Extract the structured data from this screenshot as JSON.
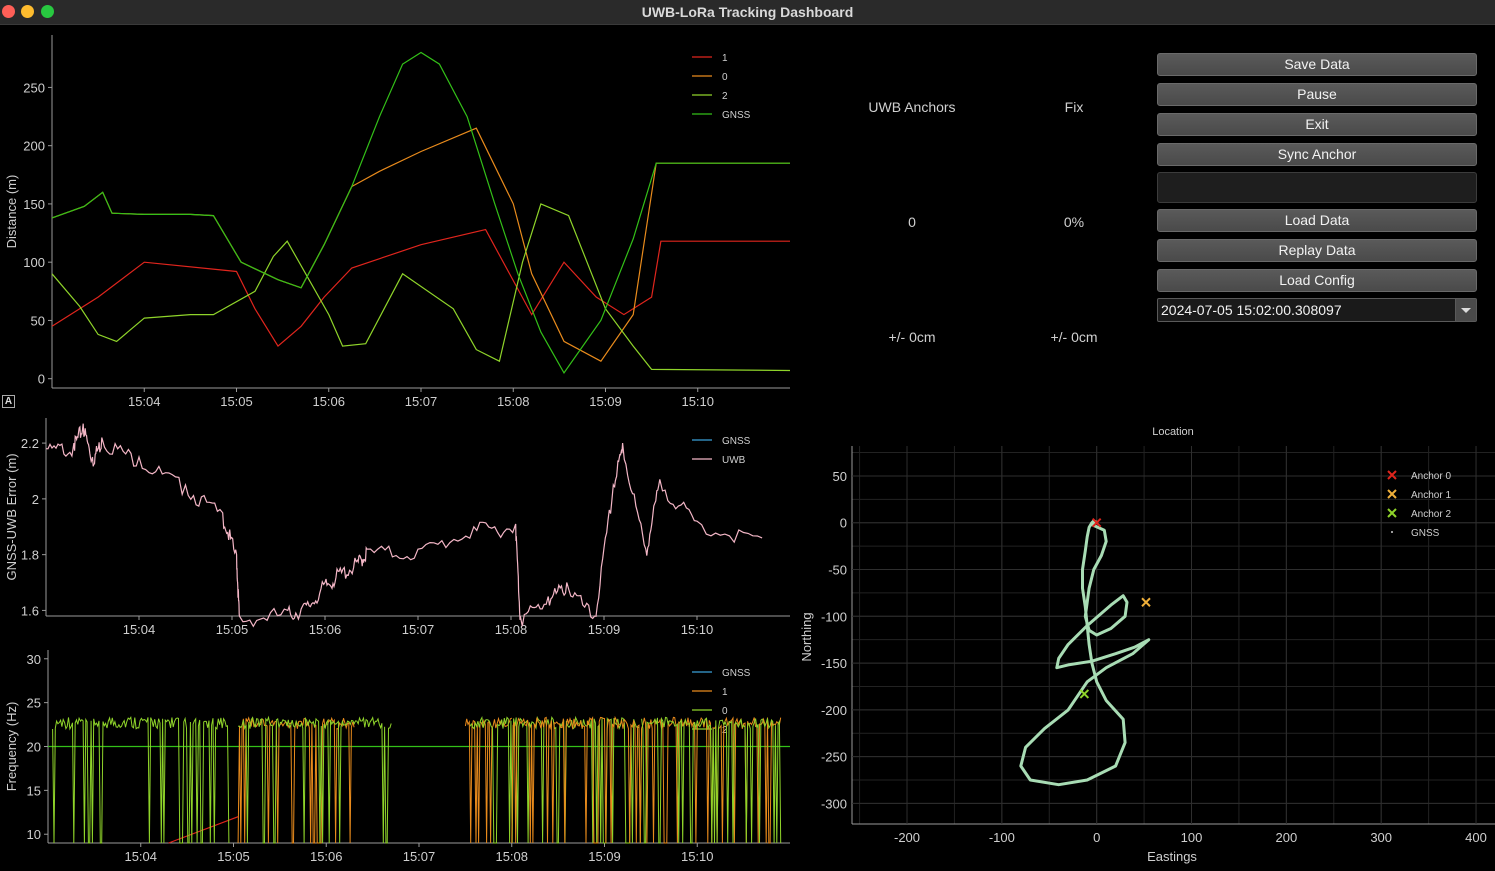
{
  "window": {
    "title": "UWB-LoRa Tracking Dashboard"
  },
  "status": {
    "anchors_header": "UWB Anchors",
    "fix_header": "Fix",
    "anchors_value": "0",
    "fix_value": "0%",
    "anchors_precision": "+/- 0cm",
    "fix_precision": "+/- 0cm"
  },
  "controls": {
    "save": "Save Data",
    "pause": "Pause",
    "exit": "Exit",
    "sync": "Sync Anchor",
    "load": "Load Data",
    "replay": "Replay Data",
    "load_config": "Load Config",
    "timestamp": "2024-07-05 15:02:00.308097",
    "autorange_label": "A"
  },
  "colors": {
    "series1": "#e0251d",
    "series0": "#e98b1c",
    "series2": "#8fd42a",
    "gnss": "#33c018",
    "uwb": "#f3b6c6",
    "gnss_err": "#3aa0d8",
    "track": "#a8dcb4"
  },
  "chart_data": [
    {
      "type": "line",
      "ylabel": "Distance (m)",
      "yticks": [
        0,
        50,
        100,
        150,
        200,
        250
      ],
      "ylim": [
        -8,
        295
      ],
      "xticks": [
        "15:04",
        "15:05",
        "15:06",
        "15:07",
        "15:08",
        "15:09",
        "15:10"
      ],
      "xlim_minutes": [
        3.0,
        11.0
      ],
      "legend": [
        "1",
        "0",
        "2",
        "GNSS"
      ],
      "series": [
        {
          "name": "1",
          "x": [
            3.0,
            3.5,
            4.0,
            5.0,
            5.2,
            5.45,
            5.7,
            5.95,
            6.25,
            7.0,
            7.7,
            8.2,
            8.55,
            8.9,
            9.2,
            9.5,
            9.6,
            11.0
          ],
          "y": [
            45,
            70,
            100,
            92,
            60,
            28,
            45,
            70,
            95,
            115,
            128,
            55,
            100,
            70,
            55,
            70,
            118,
            118
          ]
        },
        {
          "name": "0",
          "x": [
            3.0,
            3.35,
            3.55,
            3.65,
            4.0,
            4.5,
            4.75,
            5.05,
            5.45,
            5.7,
            5.95,
            6.25,
            6.55,
            7.0,
            7.6,
            8.0,
            8.2,
            8.55,
            8.95,
            9.3,
            9.55,
            11.0
          ],
          "y": [
            138,
            148,
            160,
            142,
            141,
            141,
            140,
            100,
            85,
            78,
            115,
            165,
            178,
            195,
            215,
            150,
            90,
            32,
            15,
            55,
            185,
            185
          ]
        },
        {
          "name": "2",
          "x": [
            3.0,
            3.3,
            3.5,
            3.7,
            4.0,
            4.5,
            4.75,
            5.2,
            5.4,
            5.55,
            5.75,
            6.0,
            6.15,
            6.4,
            6.8,
            7.35,
            7.6,
            7.85,
            8.1,
            8.3,
            8.6,
            9.0,
            9.3,
            9.5,
            11.0
          ],
          "y": [
            90,
            62,
            38,
            32,
            52,
            55,
            55,
            75,
            105,
            118,
            90,
            55,
            28,
            30,
            90,
            60,
            25,
            15,
            100,
            150,
            140,
            60,
            28,
            8,
            7
          ]
        },
        {
          "name": "GNSS",
          "x": [
            3.0,
            3.35,
            3.55,
            3.65,
            4.0,
            4.5,
            4.75,
            5.05,
            5.45,
            5.7,
            5.95,
            6.25,
            6.55,
            6.8,
            7.0,
            7.2,
            7.5,
            7.8,
            8.05,
            8.3,
            8.55,
            8.95,
            9.3,
            9.55,
            11.0
          ],
          "y": [
            138,
            148,
            160,
            142,
            141,
            141,
            140,
            100,
            85,
            78,
            115,
            165,
            225,
            270,
            280,
            270,
            225,
            150,
            90,
            40,
            5,
            50,
            120,
            185,
            185
          ]
        }
      ]
    },
    {
      "type": "line",
      "ylabel": "GNSS-UWB Error (m)",
      "yticks": [
        1.6,
        1.8,
        2.0,
        2.2
      ],
      "ylim": [
        1.58,
        2.29
      ],
      "xticks": [
        "15:04",
        "15:05",
        "15:06",
        "15:07",
        "15:08",
        "15:09",
        "15:10"
      ],
      "xlim_minutes": [
        3.0,
        11.0
      ],
      "legend": [
        "GNSS",
        "UWB"
      ],
      "series": [
        {
          "name": "UWB",
          "x": [
            3.0,
            3.3,
            3.4,
            3.5,
            3.6,
            4.0,
            4.5,
            4.9,
            5.05,
            5.08,
            5.6,
            5.8,
            6.0,
            6.15,
            6.35,
            6.45,
            7.0,
            7.6,
            8.05,
            8.1,
            8.4,
            8.6,
            8.9,
            9.1,
            9.2,
            9.45,
            9.6,
            10.0,
            10.7
          ],
          "y": [
            2.18,
            2.2,
            2.27,
            2.15,
            2.22,
            2.15,
            2.05,
            1.95,
            1.8,
            1.58,
            1.6,
            1.62,
            1.7,
            1.74,
            1.78,
            1.82,
            1.82,
            1.9,
            1.91,
            1.58,
            1.65,
            1.7,
            1.58,
            2.05,
            2.2,
            1.82,
            2.07,
            1.92,
            1.86
          ]
        }
      ]
    },
    {
      "type": "line",
      "ylabel": "Frequency (Hz)",
      "yticks": [
        10,
        15,
        20,
        25,
        30
      ],
      "ylim": [
        9,
        31
      ],
      "xticks": [
        "15:04",
        "15:05",
        "15:06",
        "15:07",
        "15:08",
        "15:09",
        "15:10"
      ],
      "xlim_minutes": [
        3.0,
        11.0
      ],
      "legend": [
        "GNSS",
        "1",
        "0",
        "2"
      ],
      "series": [
        {
          "name": "GNSS",
          "x": [
            3.0,
            11.0
          ],
          "y": [
            20,
            20
          ]
        },
        {
          "name": "1",
          "x": [
            4.3,
            5.05
          ],
          "y": [
            9,
            12
          ]
        }
      ]
    },
    {
      "type": "scatter",
      "title": "Location",
      "xlabel": "Eastings",
      "ylabel": "Northing",
      "xticks": [
        -200,
        -100,
        0,
        100,
        200,
        300,
        400
      ],
      "yticks": [
        50,
        0,
        -50,
        -100,
        -150,
        -200,
        -250,
        -300
      ],
      "xlim": [
        -258,
        420
      ],
      "ylim": [
        -322,
        82
      ],
      "legend": [
        "Anchor 0",
        "Anchor 1",
        "Anchor 2",
        "GNSS"
      ],
      "anchors": [
        {
          "name": "Anchor 0",
          "x": 0,
          "y": 0
        },
        {
          "name": "Anchor 1",
          "x": 52,
          "y": -85
        },
        {
          "name": "Anchor 2",
          "x": -13,
          "y": -183
        }
      ],
      "track": {
        "x": [
          -5,
          8,
          10,
          5,
          -3,
          -8,
          -10,
          -12,
          -8,
          0,
          15,
          30,
          32,
          28,
          15,
          -10,
          -30,
          -40,
          -42,
          -30,
          -5,
          20,
          40,
          55,
          38,
          10,
          -10,
          -20,
          -30,
          -55,
          -75,
          -80,
          -70,
          -40,
          -10,
          20,
          30,
          28,
          10,
          0,
          -5,
          -8,
          -10,
          -12,
          -15,
          -15,
          -12,
          -10,
          -8,
          -5,
          -3,
          -1,
          -5
        ],
        "y": [
          -2,
          -8,
          -20,
          -35,
          -50,
          -70,
          -85,
          -100,
          -115,
          -120,
          -113,
          -100,
          -85,
          -78,
          -88,
          -110,
          -130,
          -145,
          -155,
          -152,
          -148,
          -140,
          -133,
          -125,
          -140,
          -155,
          -170,
          -185,
          -200,
          -220,
          -240,
          -260,
          -275,
          -280,
          -275,
          -260,
          -235,
          -210,
          -190,
          -170,
          -150,
          -130,
          -110,
          -90,
          -70,
          -50,
          -30,
          -15,
          -5,
          0,
          2,
          1,
          -2
        ]
      }
    }
  ]
}
